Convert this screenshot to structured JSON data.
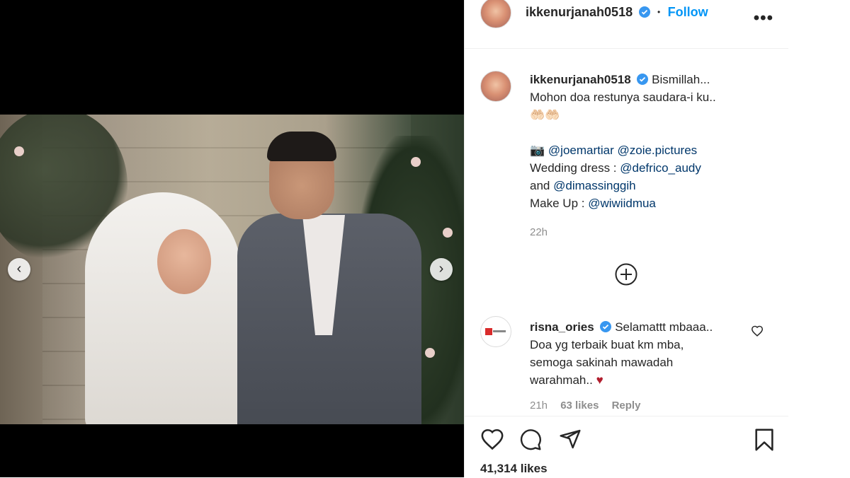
{
  "post": {
    "username": "ikkenurjanah0518",
    "follow_label": "Follow",
    "separator": "•",
    "more_label": "•••"
  },
  "caption": {
    "username": "ikkenurjanah0518",
    "line1": "Bismillah...",
    "line2": "Mohon doa restunya saudara-i ku..",
    "emoji": "🤲🏻🤲🏻",
    "camera_emoji": "📷",
    "mention1": "@joemartiar",
    "mention2": "@zoie.pictures",
    "dress_label": "Wedding dress :",
    "mention3": "@defrico_audy",
    "and_label": "and",
    "mention4": "@dimassinggih",
    "makeup_label": "Make Up :",
    "mention5": "@wiwiidmua",
    "time": "22h"
  },
  "load_more": "+",
  "comment": {
    "username": "risna_ories",
    "text1": "Selamattt mbaaa..",
    "text2": "Doa yg terbaik buat km mba,",
    "text3": "semoga sakinah mawadah",
    "text4": "warahmah..",
    "heart_emoji": "♥",
    "time": "21h",
    "likes": "63 likes",
    "reply": "Reply"
  },
  "footer": {
    "likes": "41,314 likes"
  },
  "carousel": {
    "prev": "‹",
    "next": "›"
  },
  "colors": {
    "accent": "#0095f6",
    "verified": "#3897f0",
    "mention": "#00376b",
    "muted": "#8e8e8e",
    "heart": "#b11d2d"
  },
  "icons": [
    "heart-icon",
    "comment-icon",
    "share-icon",
    "bookmark-icon",
    "verified-icon",
    "add-circle-icon",
    "like-comment-icon"
  ]
}
